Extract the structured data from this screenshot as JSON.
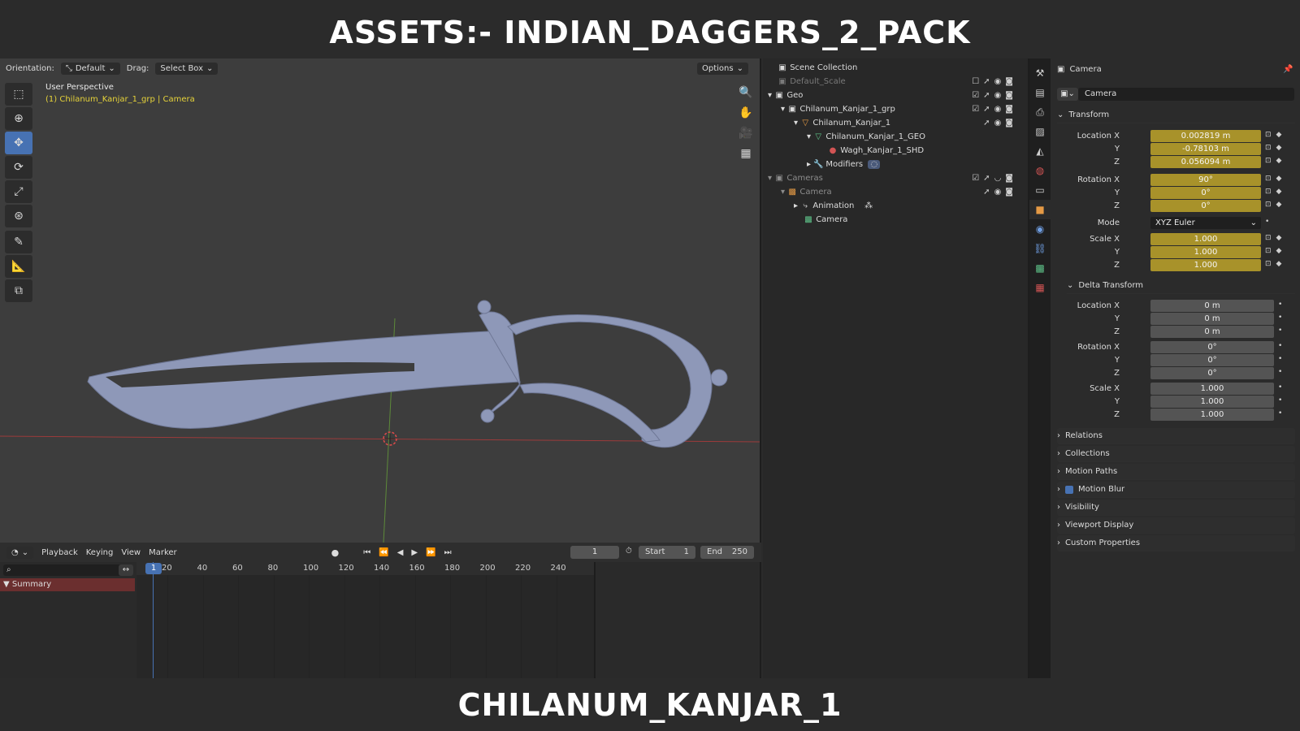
{
  "banner": {
    "title": "ASSETS:- INDIAN_DAGGERS_2_PACK",
    "subtitle": "CHILANUM_KANJAR_1"
  },
  "viewport": {
    "orientation_label": "Orientation:",
    "orientation_value": "Default",
    "drag_label": "Drag:",
    "drag_value": "Select Box",
    "options_label": "Options",
    "view_name": "User Perspective",
    "active_object": "(1) Chilanum_Kanjar_1_grp | Camera",
    "accent": "#4772b3",
    "mesh_color": "#8e98b8"
  },
  "timeline": {
    "menus": [
      "Playback",
      "Keying",
      "View",
      "Marker"
    ],
    "current_frame": "1",
    "start_label": "Start",
    "start_value": "1",
    "end_label": "End",
    "end_value": "250",
    "ruler": [
      "1",
      "20",
      "40",
      "60",
      "80",
      "100",
      "120",
      "140",
      "160",
      "180",
      "200",
      "220",
      "240"
    ],
    "summary_label": "Summary"
  },
  "outliner": {
    "rows": [
      {
        "label": "Scene Collection"
      },
      {
        "label": "Default_Scale"
      },
      {
        "label": "Geo"
      },
      {
        "label": "Chilanum_Kanjar_1_grp"
      },
      {
        "label": "Chilanum_Kanjar_1"
      },
      {
        "label": "Chilanum_Kanjar_1_GEO"
      },
      {
        "label": "Wagh_Kanjar_1_SHD"
      },
      {
        "label": "Modifiers"
      },
      {
        "label": "Cameras"
      },
      {
        "label": "Camera"
      },
      {
        "label": "Animation"
      },
      {
        "label": "Camera"
      }
    ]
  },
  "properties": {
    "header_object": "Camera",
    "object_name": "Camera",
    "transform_label": "Transform",
    "location": {
      "label": "Location X",
      "x": "0.002819 m",
      "y": "-0.78103 m",
      "z": "0.056094 m"
    },
    "rotation": {
      "label": "Rotation X",
      "x": "90°",
      "y": "0°",
      "z": "0°"
    },
    "mode_label": "Mode",
    "mode_value": "XYZ Euler",
    "scale": {
      "label": "Scale X",
      "x": "1.000",
      "y": "1.000",
      "z": "1.000"
    },
    "axis_y": "Y",
    "axis_z": "Z",
    "delta_label": "Delta Transform",
    "delta_location": {
      "label": "Location X",
      "x": "0 m",
      "y": "0 m",
      "z": "0 m"
    },
    "delta_rotation": {
      "label": "Rotation X",
      "x": "0°",
      "y": "0°",
      "z": "0°"
    },
    "delta_scale": {
      "label": "Scale X",
      "x": "1.000",
      "y": "1.000",
      "z": "1.000"
    },
    "sections": [
      "Relations",
      "Collections",
      "Motion Paths",
      "Motion Blur",
      "Visibility",
      "Viewport Display",
      "Custom Properties"
    ],
    "keyframe_color": "#a8922a"
  }
}
